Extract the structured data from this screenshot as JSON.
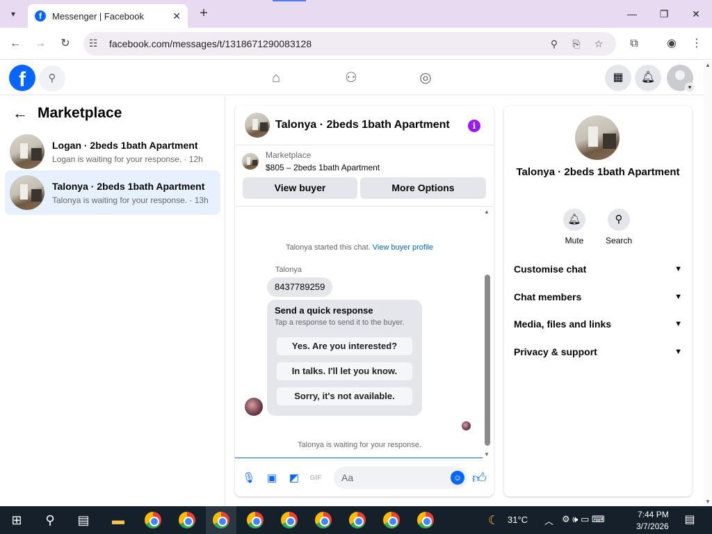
{
  "browser": {
    "tab_title": "Messenger | Facebook",
    "url": "facebook.com/messages/t/1318671290083128",
    "tab_favicon_letter": "f",
    "icons": [
      "tab-dropdown-icon",
      "close-tab-icon",
      "new-tab-icon",
      "minimize-icon",
      "maximize-icon",
      "close-window-icon",
      "back-icon",
      "forward-icon",
      "reload-icon",
      "site-settings-icon",
      "zoom-icon",
      "install-icon",
      "bookmark-star-icon",
      "extensions-icon",
      "profile-icon",
      "menu-icon"
    ]
  },
  "fb": {
    "logo": "f",
    "icons": [
      "search-icon",
      "home-icon",
      "friends-icon",
      "groups-icon",
      "menu-grid-icon",
      "notifications-icon",
      "account-avatar"
    ]
  },
  "sidebar": {
    "title": "Marketplace",
    "items": [
      {
        "name": "Logan · 2beds 1bath Apartment",
        "sub": "Logan is waiting for your response. · 12h"
      },
      {
        "name": "Talonya · 2beds 1bath Apartment",
        "sub": "Talonya is waiting for your response. · 13h"
      }
    ]
  },
  "chat": {
    "title": "Talonya · 2beds 1bath Apartment",
    "marketplace_label": "Marketplace",
    "listing": "$805 – 2beds 1bath Apartment",
    "view_buyer": "View buyer",
    "more_options": "More Options",
    "started_text": "Talonya started this chat.",
    "view_profile_link": "View buyer profile",
    "sender": "Talonya",
    "message": "8437789259",
    "quick_title": "Send a quick response",
    "quick_sub": "Tap a response to send it to the buyer.",
    "quick_replies": [
      "Yes. Are you interested?",
      "In talks. I'll let you know.",
      "Sorry, it's not available."
    ],
    "waiting": "Talonya is waiting for your response.",
    "composer_placeholder": "Aa",
    "accent": "#0866ff"
  },
  "info": {
    "name": "Talonya · 2beds 1bath Apartment",
    "mute": "Mute",
    "search": "Search",
    "sections": [
      "Customise chat",
      "Chat members",
      "Media, files and links",
      "Privacy & support"
    ]
  },
  "taskbar": {
    "temperature": "31°C",
    "time": "7:44 PM",
    "date": "3/7/2026"
  }
}
